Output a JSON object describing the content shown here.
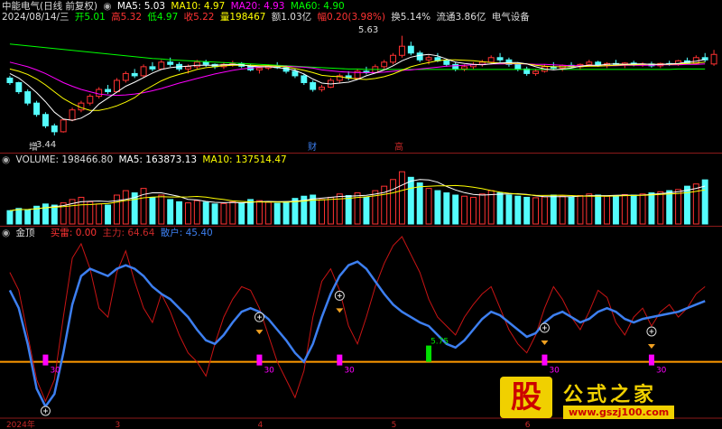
{
  "price_header": {
    "name": "中能电气(日线 前复权)",
    "ma5": "MA5: 5.03",
    "ma10": "MA10: 4.97",
    "ma20": "MA20: 4.93",
    "ma60": "MA60: 4.90",
    "date": "2024/08/14/三",
    "open": "开5.01",
    "high": "高5.32",
    "low": "低4.97",
    "close": "收5.22",
    "volume": "量198467",
    "amount": "额1.03亿",
    "change": "幅0.20(3.98%)",
    "turnover": "换5.14%",
    "float_cap": "流通3.86亿",
    "sector": "电气设备",
    "high_label": "5.63",
    "low_label": "3.44",
    "marker_zeng": "增",
    "marker_cai": "财",
    "marker_gao": "高"
  },
  "volume_header": {
    "name": "VOLUME: 198466.80",
    "ma5": "MA5: 163873.13",
    "ma10": "MA10: 137514.47"
  },
  "indicator_header": {
    "name": "金顶",
    "buy": "买雷: 0.00",
    "main": "主力: 64.64",
    "retail": "散户: 45.40"
  },
  "signal_labels": [
    "30",
    "30",
    "30",
    "30",
    "30",
    "5.75"
  ],
  "x_axis": {
    "labels": [
      "2024年",
      "3",
      "4",
      "5",
      "6"
    ]
  },
  "watermark": {
    "big": "股",
    "title": "公式之家",
    "url": "www.gszj100.com"
  },
  "colors": {
    "up": "#ff3232",
    "down": "#54fcfc",
    "ma5": "#ffffff",
    "ma10": "#ffff00",
    "ma20": "#ff00ff",
    "ma60": "#00ff00",
    "main": "#c81414",
    "retail": "#3d7ff0",
    "signal_line": "#ff9900",
    "magenta": "#ff00ff",
    "green_bar": "#00e000"
  },
  "chart_data": {
    "type": "candlestick+volume+indicator",
    "price": {
      "ylim": [
        3.2,
        5.9
      ],
      "candles": [
        [
          4.7,
          4.75,
          4.55,
          4.6
        ],
        [
          4.6,
          4.62,
          4.35,
          4.4
        ],
        [
          4.4,
          4.45,
          4.1,
          4.15
        ],
        [
          4.15,
          4.2,
          3.85,
          3.9
        ],
        [
          3.9,
          3.95,
          3.6,
          3.65
        ],
        [
          3.65,
          3.7,
          3.44,
          3.52
        ],
        [
          3.52,
          3.8,
          3.5,
          3.78
        ],
        [
          3.78,
          4.05,
          3.75,
          4.0
        ],
        [
          4.0,
          4.2,
          3.95,
          4.15
        ],
        [
          4.15,
          4.35,
          4.1,
          4.3
        ],
        [
          4.3,
          4.5,
          4.25,
          4.45
        ],
        [
          4.45,
          4.55,
          4.35,
          4.4
        ],
        [
          4.4,
          4.7,
          4.38,
          4.65
        ],
        [
          4.65,
          4.85,
          4.6,
          4.8
        ],
        [
          4.8,
          4.9,
          4.7,
          4.75
        ],
        [
          4.75,
          5.0,
          4.72,
          4.95
        ],
        [
          4.95,
          5.05,
          4.85,
          4.9
        ],
        [
          4.9,
          5.1,
          4.88,
          5.05
        ],
        [
          5.05,
          5.15,
          4.95,
          5.0
        ],
        [
          5.0,
          5.05,
          4.85,
          4.9
        ],
        [
          4.9,
          5.0,
          4.8,
          4.95
        ],
        [
          4.95,
          5.1,
          4.9,
          5.05
        ],
        [
          5.05,
          5.1,
          4.95,
          5.0
        ],
        [
          5.0,
          5.02,
          4.9,
          4.95
        ],
        [
          4.95,
          5.05,
          4.9,
          5.0
        ],
        [
          5.0,
          5.08,
          4.95,
          5.02
        ],
        [
          5.02,
          5.05,
          4.92,
          4.96
        ],
        [
          4.96,
          5.0,
          4.85,
          4.88
        ],
        [
          4.88,
          4.95,
          4.8,
          4.92
        ],
        [
          4.92,
          5.0,
          4.88,
          4.97
        ],
        [
          4.97,
          5.05,
          4.9,
          4.93
        ],
        [
          4.93,
          4.98,
          4.8,
          4.85
        ],
        [
          4.85,
          4.9,
          4.7,
          4.75
        ],
        [
          4.75,
          4.8,
          4.55,
          4.6
        ],
        [
          4.6,
          4.65,
          4.4,
          4.45
        ],
        [
          4.45,
          4.55,
          4.4,
          4.5
        ],
        [
          4.5,
          4.7,
          4.48,
          4.65
        ],
        [
          4.65,
          4.8,
          4.6,
          4.75
        ],
        [
          4.75,
          4.85,
          4.65,
          4.7
        ],
        [
          4.7,
          4.9,
          4.68,
          4.85
        ],
        [
          4.85,
          4.95,
          4.78,
          4.82
        ],
        [
          4.82,
          5.0,
          4.8,
          4.95
        ],
        [
          4.95,
          5.1,
          4.9,
          5.05
        ],
        [
          5.05,
          5.25,
          5.0,
          5.2
        ],
        [
          5.2,
          5.63,
          5.15,
          5.4
        ],
        [
          5.4,
          5.5,
          5.2,
          5.25
        ],
        [
          5.25,
          5.3,
          5.05,
          5.1
        ],
        [
          5.1,
          5.2,
          5.0,
          5.15
        ],
        [
          5.15,
          5.25,
          5.05,
          5.08
        ],
        [
          5.08,
          5.12,
          4.95,
          5.0
        ],
        [
          5.0,
          5.05,
          4.85,
          4.9
        ],
        [
          4.9,
          5.0,
          4.85,
          4.95
        ],
        [
          4.95,
          5.05,
          4.9,
          5.0
        ],
        [
          5.0,
          5.1,
          4.95,
          5.05
        ],
        [
          5.05,
          5.2,
          5.0,
          5.15
        ],
        [
          5.15,
          5.25,
          5.05,
          5.1
        ],
        [
          5.1,
          5.15,
          4.95,
          5.0
        ],
        [
          5.0,
          5.05,
          4.85,
          4.9
        ],
        [
          4.9,
          4.95,
          4.75,
          4.8
        ],
        [
          4.8,
          4.9,
          4.75,
          4.85
        ],
        [
          4.85,
          5.0,
          4.82,
          4.95
        ],
        [
          4.95,
          5.05,
          4.88,
          4.92
        ],
        [
          4.92,
          5.0,
          4.85,
          4.98
        ],
        [
          4.98,
          5.05,
          4.92,
          4.95
        ],
        [
          4.95,
          5.02,
          4.88,
          5.0
        ],
        [
          5.0,
          5.1,
          4.95,
          5.05
        ],
        [
          5.05,
          5.08,
          4.95,
          4.98
        ],
        [
          4.98,
          5.05,
          4.92,
          5.02
        ],
        [
          5.02,
          5.1,
          4.98,
          5.0
        ],
        [
          5.0,
          5.05,
          4.92,
          5.03
        ],
        [
          5.03,
          5.08,
          4.96,
          4.99
        ],
        [
          4.99,
          5.05,
          4.95,
          5.01
        ],
        [
          5.01,
          5.06,
          4.93,
          4.97
        ],
        [
          4.97,
          5.04,
          4.92,
          5.02
        ],
        [
          5.02,
          5.08,
          4.97,
          5.0
        ],
        [
          5.0,
          5.1,
          4.97,
          5.08
        ],
        [
          5.08,
          5.15,
          5.0,
          5.02
        ],
        [
          5.02,
          5.2,
          5.0,
          5.15
        ],
        [
          5.15,
          5.25,
          5.05,
          5.1
        ],
        [
          5.01,
          5.32,
          4.97,
          5.22
        ]
      ],
      "ma5": [
        4.8,
        4.7,
        4.55,
        4.38,
        4.18,
        3.95,
        3.8,
        3.77,
        3.82,
        3.93,
        4.13,
        4.26,
        4.39,
        4.52,
        4.61,
        4.71,
        4.81,
        4.89,
        4.93,
        4.95,
        4.96,
        4.98,
        4.98,
        4.98,
        4.99,
        5.0,
        4.99,
        4.96,
        4.95,
        4.95,
        4.93,
        4.91,
        4.87,
        4.79,
        4.68,
        4.59,
        4.57,
        4.59,
        4.61,
        4.67,
        4.75,
        4.81,
        4.88,
        4.97,
        5.08,
        5.16,
        5.2,
        5.22,
        5.19,
        5.12,
        5.05,
        5.02,
        5.0,
        4.99,
        5.01,
        5.03,
        5.04,
        5.04,
        5.01,
        4.95,
        4.9,
        4.88,
        4.9,
        4.92,
        4.96,
        4.98,
        4.98,
        5.0,
        5.01,
        5.0,
        5.01,
        5.01,
        5.0,
        5.0,
        5.01,
        5.02,
        5.05,
        5.07,
        5.11
      ],
      "ma10": [
        4.9,
        4.85,
        4.78,
        4.68,
        4.55,
        4.4,
        4.25,
        4.14,
        4.05,
        3.99,
        3.99,
        4.03,
        4.09,
        4.17,
        4.27,
        4.42,
        4.53,
        4.64,
        4.72,
        4.78,
        4.83,
        4.89,
        4.93,
        4.95,
        4.97,
        4.98,
        4.98,
        4.98,
        4.97,
        4.97,
        4.96,
        4.95,
        4.91,
        4.87,
        4.82,
        4.76,
        4.74,
        4.73,
        4.7,
        4.68,
        4.67,
        4.69,
        4.73,
        4.79,
        4.87,
        4.95,
        5.0,
        5.04,
        5.08,
        5.1,
        5.1,
        5.09,
        5.08,
        5.06,
        5.04,
        5.03,
        5.02,
        5.02,
        5.01,
        4.98,
        4.96,
        4.95,
        4.95,
        4.95,
        4.95,
        4.96,
        4.96,
        4.97,
        4.98,
        4.99,
        4.99,
        5.0,
        5.0,
        5.0,
        5.0,
        5.01,
        5.02,
        5.03,
        5.05
      ],
      "ma20": [
        5.05,
        5.0,
        4.95,
        4.88,
        4.8,
        4.7,
        4.6,
        4.52,
        4.45,
        4.4,
        4.35,
        4.33,
        4.32,
        4.33,
        4.35,
        4.38,
        4.42,
        4.47,
        4.53,
        4.59,
        4.64,
        4.69,
        4.74,
        4.79,
        4.83,
        4.87,
        4.9,
        4.92,
        4.94,
        4.95,
        4.96,
        4.96,
        4.95,
        4.94,
        4.92,
        4.88,
        4.86,
        4.84,
        4.83,
        4.82,
        4.82,
        4.82,
        4.83,
        4.85,
        4.87,
        4.88,
        4.9,
        4.92,
        4.94,
        4.96,
        4.97,
        4.98,
        4.99,
        5.0,
        5.01,
        5.01,
        5.01,
        5.01,
        5.01,
        5.0,
        5.0,
        4.99,
        4.98,
        4.97,
        4.97,
        4.97,
        4.97,
        4.97,
        4.97,
        4.98,
        4.98,
        4.98,
        4.98,
        4.99,
        4.99,
        4.99,
        5.0,
        5.0,
        5.01
      ],
      "ma60": [
        5.45,
        5.43,
        5.41,
        5.39,
        5.37,
        5.35,
        5.33,
        5.31,
        5.29,
        5.27,
        5.25,
        5.23,
        5.21,
        5.19,
        5.17,
        5.15,
        5.13,
        5.12,
        5.1,
        5.09,
        5.08,
        5.07,
        5.06,
        5.05,
        5.04,
        5.03,
        5.02,
        5.01,
        5.0,
        4.99,
        4.98,
        4.97,
        4.96,
        4.95,
        4.94,
        4.93,
        4.92,
        4.91,
        4.9,
        4.9,
        4.89,
        4.89,
        4.89,
        4.89,
        4.89,
        4.89,
        4.89,
        4.89,
        4.89,
        4.89,
        4.89,
        4.89,
        4.89,
        4.89,
        4.89,
        4.89,
        4.89,
        4.89,
        4.89,
        4.89,
        4.89,
        4.89,
        4.89,
        4.89,
        4.89,
        4.89,
        4.89,
        4.89,
        4.89,
        4.89,
        4.89,
        4.89,
        4.89,
        4.89,
        4.89,
        4.9,
        4.9,
        4.9,
        4.9
      ]
    },
    "volume": {
      "ylim": [
        0,
        260000
      ],
      "values": [
        60000,
        70000,
        65000,
        80000,
        90000,
        85000,
        95000,
        110000,
        120000,
        100000,
        90000,
        85000,
        130000,
        150000,
        140000,
        160000,
        120000,
        130000,
        110000,
        100000,
        95000,
        105000,
        98000,
        90000,
        92000,
        100000,
        95000,
        110000,
        105000,
        98000,
        93000,
        100000,
        115000,
        125000,
        130000,
        110000,
        120000,
        135000,
        128000,
        140000,
        120000,
        150000,
        170000,
        200000,
        235000,
        210000,
        185000,
        160000,
        150000,
        140000,
        130000,
        125000,
        120000,
        135000,
        150000,
        140000,
        130000,
        125000,
        120000,
        118000,
        122000,
        130000,
        125000,
        120000,
        128000,
        135000,
        130000,
        125000,
        128000,
        132000,
        130000,
        135000,
        140000,
        145000,
        150000,
        155000,
        170000,
        180000,
        198467
      ]
    },
    "indicator": {
      "ylim": [
        0,
        100
      ],
      "main": [
        80,
        70,
        45,
        20,
        8,
        20,
        55,
        88,
        96,
        82,
        60,
        55,
        80,
        92,
        75,
        60,
        52,
        68,
        58,
        45,
        35,
        30,
        22,
        40,
        55,
        65,
        72,
        70,
        60,
        45,
        30,
        20,
        10,
        25,
        55,
        75,
        82,
        70,
        50,
        40,
        55,
        72,
        85,
        95,
        100,
        90,
        80,
        65,
        55,
        50,
        45,
        55,
        62,
        68,
        72,
        60,
        48,
        40,
        35,
        45,
        60,
        72,
        65,
        55,
        48,
        58,
        70,
        66,
        52,
        45,
        55,
        60,
        50,
        58,
        62,
        55,
        60,
        68,
        72
      ],
      "retail": [
        70,
        60,
        40,
        15,
        5,
        12,
        35,
        62,
        78,
        82,
        80,
        78,
        82,
        84,
        82,
        78,
        72,
        68,
        65,
        60,
        55,
        48,
        42,
        40,
        45,
        52,
        58,
        60,
        58,
        54,
        48,
        42,
        35,
        30,
        40,
        55,
        68,
        78,
        84,
        86,
        82,
        75,
        68,
        62,
        58,
        55,
        52,
        50,
        45,
        40,
        38,
        42,
        48,
        54,
        58,
        56,
        52,
        48,
        44,
        46,
        52,
        56,
        58,
        55,
        52,
        54,
        58,
        60,
        58,
        54,
        52,
        54,
        55,
        56,
        57,
        58,
        60,
        62,
        64
      ],
      "signal_level": 30
    },
    "x_labels": [
      "2024年",
      "3",
      "4",
      "5",
      "6"
    ],
    "ylabel": "",
    "xlabel": ""
  }
}
